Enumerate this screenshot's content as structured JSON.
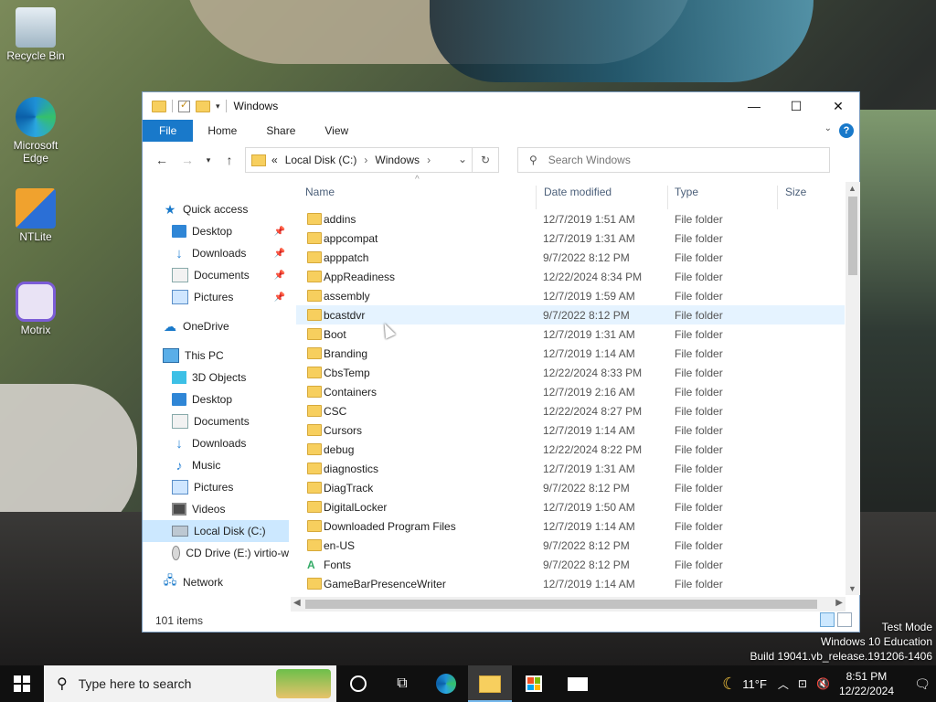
{
  "desktop": {
    "icons": [
      {
        "label": "Recycle Bin",
        "icon": "recycle-bin-icon"
      },
      {
        "label": "Microsoft Edge",
        "icon": "edge-icon"
      },
      {
        "label": "NTLite",
        "icon": "ntlite-icon"
      },
      {
        "label": "Motrix",
        "icon": "motrix-icon"
      }
    ],
    "watermark": {
      "line1": "Test Mode",
      "line2": "Windows 10 Education",
      "line3": "Build 19041.vb_release.191206-1406"
    }
  },
  "explorer": {
    "title": "Windows",
    "ribbon_tabs": [
      "File",
      "Home",
      "Share",
      "View"
    ],
    "address": {
      "overflow": "«",
      "crumbs": [
        "Local Disk (C:)",
        "Windows"
      ]
    },
    "search_placeholder": "Search Windows",
    "nav_pane": [
      {
        "label": "Quick access",
        "icon": "star-icon",
        "pinned": false
      },
      {
        "label": "Desktop",
        "icon": "desktop-icon",
        "pinned": true
      },
      {
        "label": "Downloads",
        "icon": "download-icon",
        "pinned": true
      },
      {
        "label": "Documents",
        "icon": "documents-icon",
        "pinned": true
      },
      {
        "label": "Pictures",
        "icon": "pictures-icon",
        "pinned": true
      },
      {
        "label": "OneDrive",
        "icon": "cloud-icon",
        "pinned": false
      },
      {
        "label": "This PC",
        "icon": "pc-icon",
        "pinned": false
      },
      {
        "label": "3D Objects",
        "icon": "3d-objects-icon",
        "pinned": false
      },
      {
        "label": "Desktop",
        "icon": "desktop-icon",
        "pinned": false
      },
      {
        "label": "Documents",
        "icon": "documents-icon",
        "pinned": false
      },
      {
        "label": "Downloads",
        "icon": "download-icon",
        "pinned": false
      },
      {
        "label": "Music",
        "icon": "music-icon",
        "pinned": false
      },
      {
        "label": "Pictures",
        "icon": "pictures-icon",
        "pinned": false
      },
      {
        "label": "Videos",
        "icon": "videos-icon",
        "pinned": false
      },
      {
        "label": "Local Disk (C:)",
        "icon": "disk-icon",
        "pinned": false,
        "selected": true
      },
      {
        "label": "CD Drive (E:) virtio-w",
        "icon": "cd-drive-icon",
        "pinned": false
      },
      {
        "label": "Network",
        "icon": "network-icon",
        "pinned": false
      }
    ],
    "columns": {
      "name": "Name",
      "date": "Date modified",
      "type": "Type",
      "size": "Size"
    },
    "files": [
      {
        "name": "addins",
        "date": "12/7/2019 1:51 AM",
        "type": "File folder"
      },
      {
        "name": "appcompat",
        "date": "12/7/2019 1:31 AM",
        "type": "File folder"
      },
      {
        "name": "apppatch",
        "date": "9/7/2022 8:12 PM",
        "type": "File folder"
      },
      {
        "name": "AppReadiness",
        "date": "12/22/2024 8:34 PM",
        "type": "File folder"
      },
      {
        "name": "assembly",
        "date": "12/7/2019 1:59 AM",
        "type": "File folder"
      },
      {
        "name": "bcastdvr",
        "date": "9/7/2022 8:12 PM",
        "type": "File folder",
        "hover": true
      },
      {
        "name": "Boot",
        "date": "12/7/2019 1:31 AM",
        "type": "File folder"
      },
      {
        "name": "Branding",
        "date": "12/7/2019 1:14 AM",
        "type": "File folder"
      },
      {
        "name": "CbsTemp",
        "date": "12/22/2024 8:33 PM",
        "type": "File folder"
      },
      {
        "name": "Containers",
        "date": "12/7/2019 2:16 AM",
        "type": "File folder"
      },
      {
        "name": "CSC",
        "date": "12/22/2024 8:27 PM",
        "type": "File folder"
      },
      {
        "name": "Cursors",
        "date": "12/7/2019 1:14 AM",
        "type": "File folder"
      },
      {
        "name": "debug",
        "date": "12/22/2024 8:22 PM",
        "type": "File folder"
      },
      {
        "name": "diagnostics",
        "date": "12/7/2019 1:31 AM",
        "type": "File folder"
      },
      {
        "name": "DiagTrack",
        "date": "9/7/2022 8:12 PM",
        "type": "File folder"
      },
      {
        "name": "DigitalLocker",
        "date": "12/7/2019 1:50 AM",
        "type": "File folder"
      },
      {
        "name": "Downloaded Program Files",
        "date": "12/7/2019 1:14 AM",
        "type": "File folder"
      },
      {
        "name": "en-US",
        "date": "9/7/2022 8:12 PM",
        "type": "File folder"
      },
      {
        "name": "Fonts",
        "date": "9/7/2022 8:12 PM",
        "type": "File folder",
        "icon": "fonts-folder-icon"
      },
      {
        "name": "GameBarPresenceWriter",
        "date": "12/7/2019 1:14 AM",
        "type": "File folder"
      }
    ],
    "status": "101 items"
  },
  "taskbar": {
    "search_placeholder": "Type here to search",
    "weather": "11°F",
    "time": "8:51 PM",
    "date": "12/22/2024",
    "notifications": "1"
  }
}
